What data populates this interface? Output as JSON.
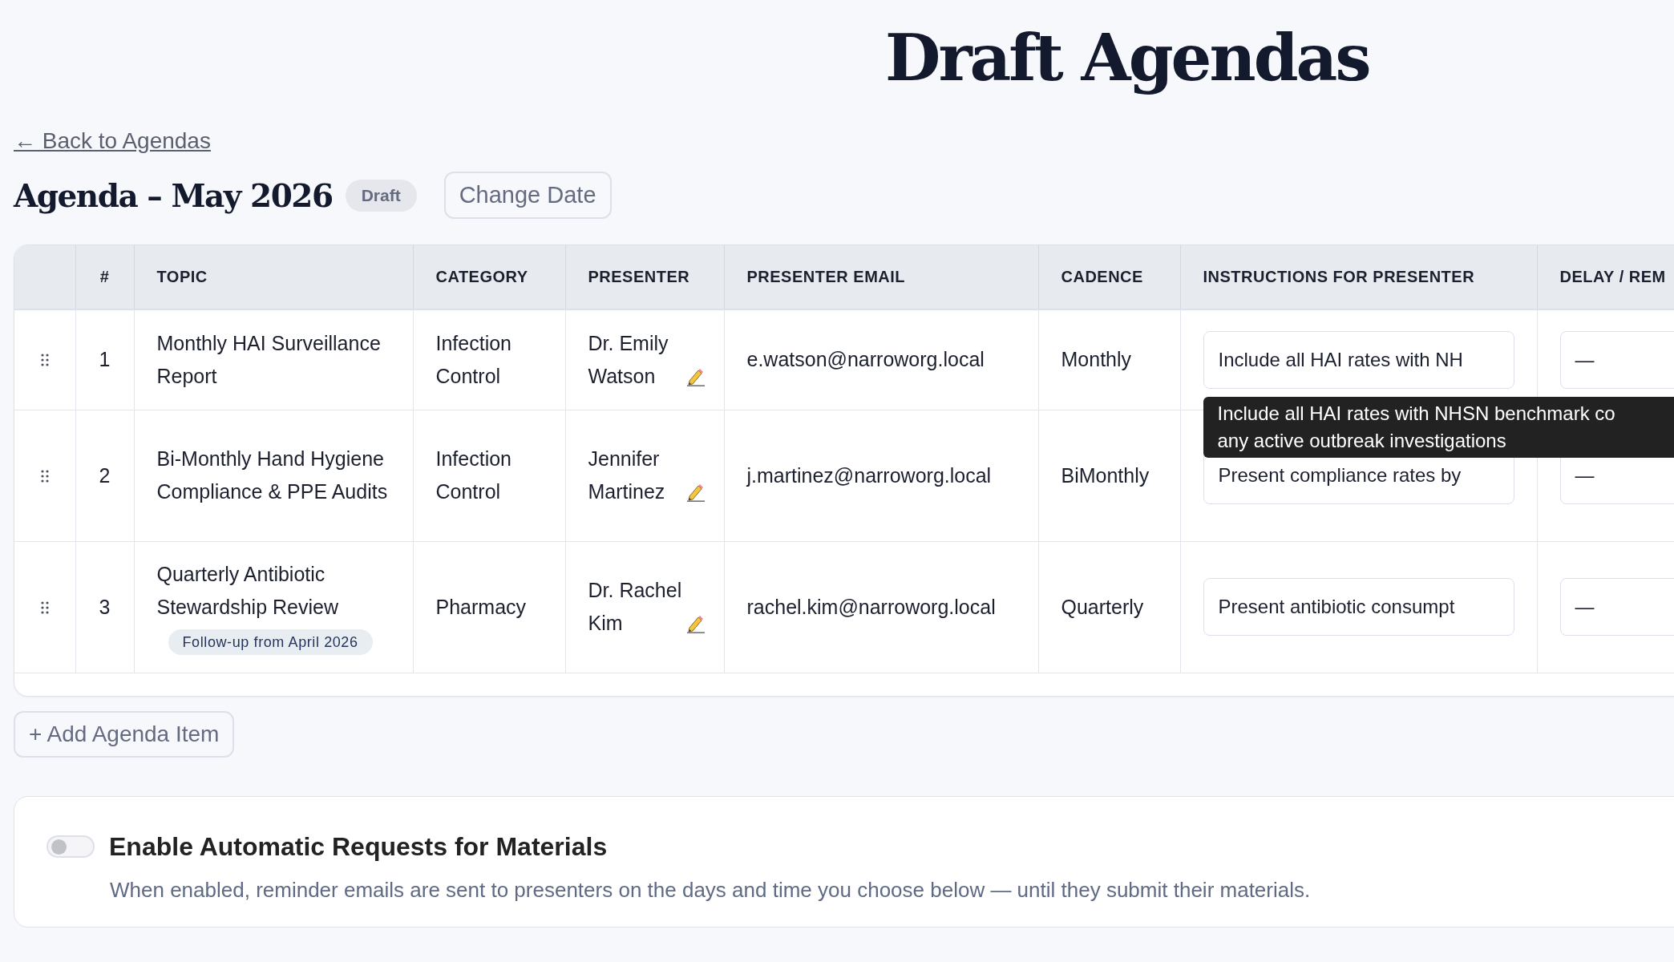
{
  "page_title": "Draft Agendas",
  "back_link": "← Back to Agendas",
  "agenda": {
    "title": "Agenda – May 2026",
    "status": "Draft",
    "change_date_button": "Change Date"
  },
  "table": {
    "columns": [
      "#",
      "TOPIC",
      "CATEGORY",
      "PRESENTER",
      "PRESENTER EMAIL",
      "CADENCE",
      "INSTRUCTIONS FOR PRESENTER",
      "DELAY / REM"
    ],
    "rows": [
      {
        "number": "1",
        "topic": "Monthly HAI Surveillance Report",
        "category": "Infection Control",
        "presenter": "Dr. Emily Watson",
        "email": "e.watson@narroworg.local",
        "cadence": "Monthly",
        "instructions": "Include all HAI rates with NH",
        "delay": "—"
      },
      {
        "number": "2",
        "topic": "Bi-Monthly Hand Hygiene Compliance & PPE Audits",
        "category": "Infection Control",
        "presenter": "Jennifer Martinez",
        "email": "j.martinez@narroworg.local",
        "cadence": "BiMonthly",
        "instructions": "Present compliance rates by",
        "delay": "—"
      },
      {
        "number": "3",
        "topic": "Quarterly Antibiotic Stewardship Review",
        "tag": "Follow-up from April 2026",
        "category": "Pharmacy",
        "presenter": "Dr. Rachel Kim",
        "email": "rachel.kim@narroworg.local",
        "cadence": "Quarterly",
        "instructions": "Present antibiotic consumpt",
        "delay": "—"
      }
    ]
  },
  "tooltip": {
    "lines": [
      "Include all HAI rates with NHSN benchmark co",
      "any active outbreak investigations"
    ]
  },
  "add_button": "+ Add Agenda Item",
  "auto_requests": {
    "on": false,
    "title": "Enable Automatic Requests for Materials",
    "description": "When enabled, reminder emails are sent to presenters on the days and time you choose below — until they submit their materials."
  }
}
